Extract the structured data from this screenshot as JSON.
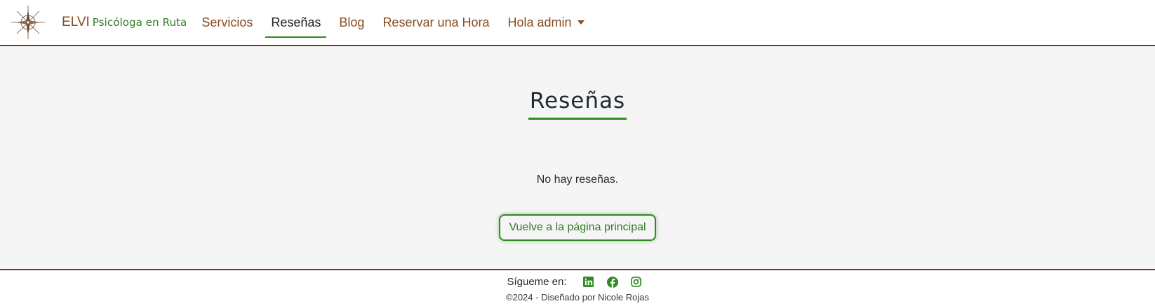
{
  "navbar": {
    "brand_main": "ELVI",
    "brand_sub": "Psicóloga en Ruta",
    "items": [
      {
        "label": "Servicios"
      },
      {
        "label": "Reseñas"
      },
      {
        "label": "Blog"
      },
      {
        "label": "Reservar una Hora"
      },
      {
        "label": "Hola admin"
      }
    ]
  },
  "main": {
    "title": "Reseñas",
    "empty_message": "No hay reseñas.",
    "home_button": "Vuelve a la página principal"
  },
  "footer": {
    "follow_label": "Sígueme en:",
    "social_icons": [
      "linkedin-icon",
      "facebook-icon",
      "instagram-icon"
    ],
    "copyright": "©2024 - Diseñado por Nicole Rojas"
  },
  "colors": {
    "brand_brown": "#8a4a1e",
    "accent_green": "#2e8b1f",
    "border_brown": "#7a3a12",
    "main_background": "#f5f5f5"
  }
}
